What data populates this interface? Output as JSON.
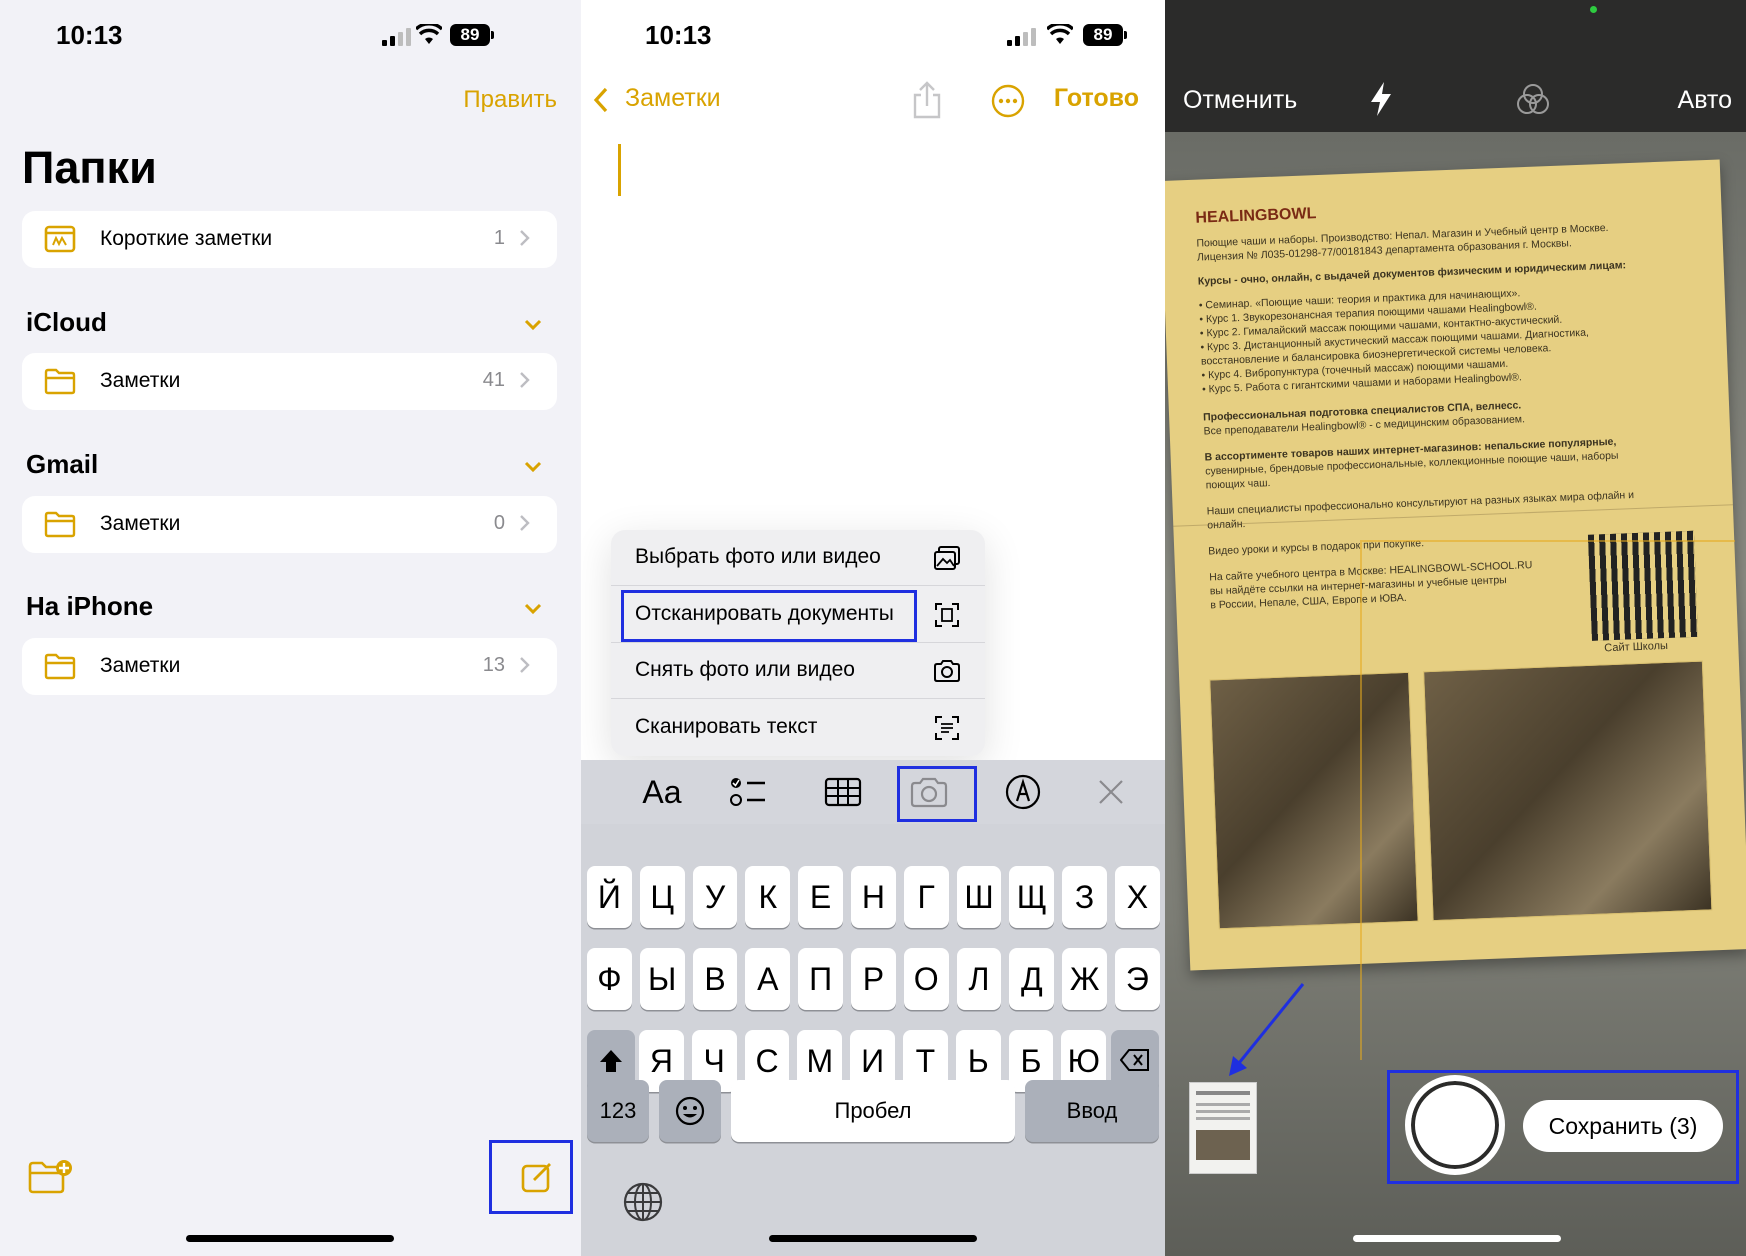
{
  "status": {
    "time": "10:13",
    "battery": "89"
  },
  "folders": {
    "edit_label": "Править",
    "title": "Папки",
    "quick_notes": {
      "label": "Короткие заметки",
      "count": "1"
    },
    "sections": [
      {
        "name": "iCloud",
        "folder": {
          "label": "Заметки",
          "count": "41"
        }
      },
      {
        "name": "Gmail",
        "folder": {
          "label": "Заметки",
          "count": "0"
        }
      },
      {
        "name": "На iPhone",
        "folder": {
          "label": "Заметки",
          "count": "13"
        }
      }
    ],
    "accent": "#d9a300",
    "highlight": "#1f2fe0"
  },
  "note": {
    "back_label": "Заметки",
    "done_label": "Готово",
    "menu": [
      {
        "label": "Выбрать фото или видео",
        "icon": "photo-library-icon"
      },
      {
        "label": "Отсканировать документы",
        "icon": "doc-scan-icon"
      },
      {
        "label": "Снять фото или видео",
        "icon": "camera-icon"
      },
      {
        "label": "Сканировать текст",
        "icon": "text-scan-icon"
      }
    ],
    "toolbar": {
      "format_label": "Aa"
    },
    "keyboard": {
      "row1": [
        "Й",
        "Ц",
        "У",
        "К",
        "Е",
        "Н",
        "Г",
        "Ш",
        "Щ",
        "З",
        "Х"
      ],
      "row2": [
        "Ф",
        "Ы",
        "В",
        "А",
        "П",
        "Р",
        "О",
        "Л",
        "Д",
        "Ж",
        "Э"
      ],
      "row3": [
        "Я",
        "Ч",
        "С",
        "М",
        "И",
        "Т",
        "Ь",
        "Б",
        "Ю"
      ],
      "numbers_label": "123",
      "space_label": "Пробел",
      "return_label": "Ввод"
    }
  },
  "camera": {
    "cancel_label": "Отменить",
    "auto_label": "Авто",
    "save_label": "Сохранить (3)",
    "document": {
      "brand": "HEALINGBOWL",
      "lines": [
        "Поющие чаши и наборы. Производство: Непал. Магазин и Учебный центр в Москве.",
        "Лицензия № Л035-01298-77/00181843 департамента образования г. Москвы.",
        "Курсы - очно, онлайн, с выдачей документов физическим и юридическим лицам:",
        "• Семинар. «Поющие чаши: теория и практика для начинающих».",
        "• Курс 1. Звукорезонансная терапия поющими чашами Healingbowl®.",
        "• Курс 2. Гималайский массаж поющими чашами, контактно-акустический.",
        "• Курс 3. Дистанционный акустический массаж поющими чашами. Диагностика,",
        "  восстановление и балансировка биоэнергетической системы человека.",
        "• Курс 4. Вибропунктура (точечный массаж) поющими чашами.",
        "• Курс 5. Работа с гигантскими чашами и наборами Healingbowl®.",
        "Профессиональная подготовка специалистов СПА, велнесс.",
        "Все преподаватели Healingbowl® - с медицинским образованием.",
        "В ассортименте товаров наших интернет-магазинов: непальские популярные,",
        "сувенирные, брендовые профессиональные, коллекционные поющие чаши, наборы",
        "поющих чаш.",
        "Наши специалисты профессионально консультируют на разных языках мира офлайн и",
        "онлайн.",
        "Видео уроки и курсы в подарок при покупке.",
        "На сайте учебного центра в Москве: HEALINGBOWL-SCHOOL.RU",
        "вы найдёте ссылки на интернет-магазины и учебные центры",
        "в России, Непале, США, Европе и ЮВА."
      ],
      "qr_caption": "Сайт Школы"
    }
  }
}
